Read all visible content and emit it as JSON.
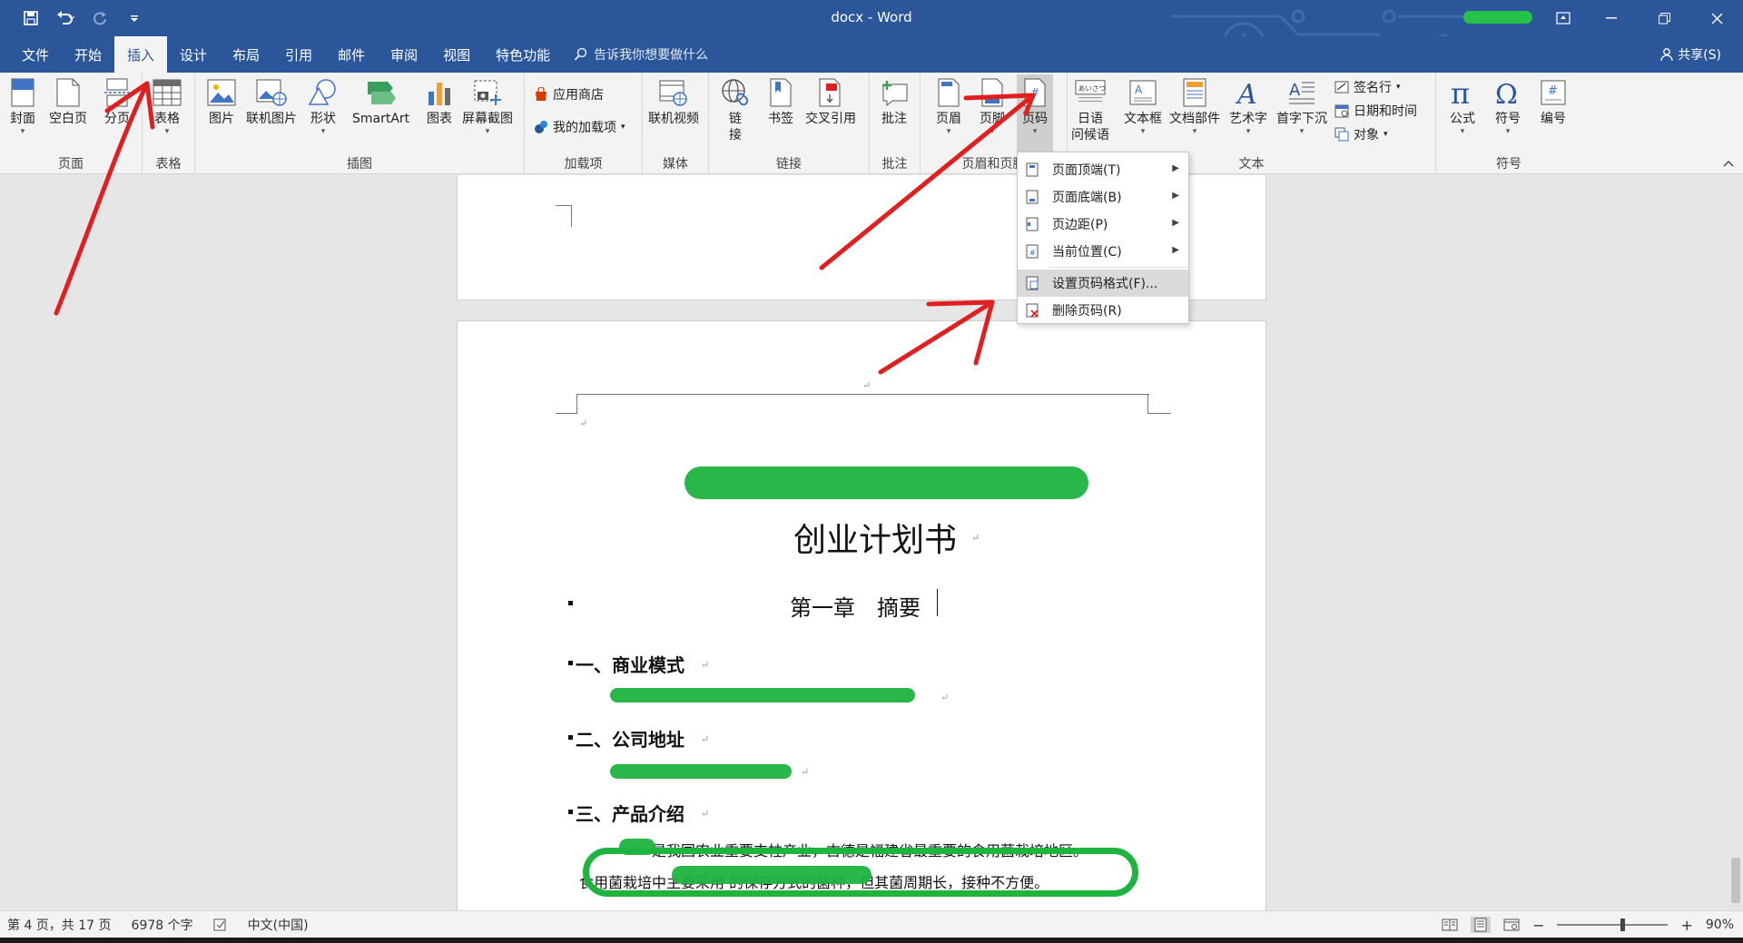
{
  "window": {
    "title": "docx - Word",
    "tooltips_hidden": "",
    "controls": [
      "minimize",
      "restore",
      "close"
    ]
  },
  "qat": {
    "icons": [
      "save-icon",
      "undo-icon",
      "redo-icon",
      "customize-icon"
    ]
  },
  "tabs": [
    {
      "label": "文件",
      "active": false
    },
    {
      "label": "开始",
      "active": false
    },
    {
      "label": "插入",
      "active": true
    },
    {
      "label": "设计",
      "active": false
    },
    {
      "label": "布局",
      "active": false
    },
    {
      "label": "引用",
      "active": false
    },
    {
      "label": "邮件",
      "active": false
    },
    {
      "label": "审阅",
      "active": false
    },
    {
      "label": "视图",
      "active": false
    },
    {
      "label": "特色功能",
      "active": false
    }
  ],
  "tellme": "告诉我你想要做什么",
  "share": "共享(S)",
  "ribbon": {
    "groups": {
      "pages": "页面",
      "tables": "表格",
      "illustrations": "插图",
      "addins": "加载项",
      "media": "媒体",
      "links": "链接",
      "comments": "批注",
      "header_footer": "页眉和页脚",
      "text": "文本",
      "symbols": "符号"
    },
    "buttons": {
      "cover": "封面",
      "blank_page": "空白页",
      "page_break": "分页",
      "table": "表格",
      "picture": "图片",
      "online_picture": "联机图片",
      "shapes": "形状",
      "smartart": "SmartArt",
      "chart": "图表",
      "screenshot": "屏幕截图",
      "store": "应用商店",
      "my_addins": "我的加载项",
      "online_video": "联机视频",
      "link_1": "链",
      "link_2": "接",
      "bookmark": "书签",
      "cross_ref": "交叉引用",
      "comment": "批注",
      "header": "页眉",
      "footer": "页脚",
      "page_number": "页码",
      "greeting_1": "日语",
      "greeting_2": "问候语",
      "textbox": "文本框",
      "doc_parts": "文档部件",
      "wordart": "艺术字",
      "dropcap": "首字下沉",
      "signature": "签名行",
      "datetime": "日期和时间",
      "object": "对象",
      "equation": "公式",
      "symbol": "符号",
      "numbering": "编号"
    }
  },
  "page_number_menu": {
    "items": [
      {
        "label": "页面顶端(T)",
        "submenu": true,
        "highlight": false
      },
      {
        "label": "页面底端(B)",
        "submenu": true,
        "highlight": false
      },
      {
        "label": "页边距(P)",
        "submenu": true,
        "highlight": false
      },
      {
        "label": "当前位置(C)",
        "submenu": true,
        "highlight": false
      },
      {
        "label": "设置页码格式(F)...",
        "submenu": false,
        "highlight": true
      },
      {
        "label": "删除页码(R)",
        "submenu": false,
        "highlight": false
      }
    ]
  },
  "document": {
    "title_line2": "创业计划书",
    "chapter": "第一章　摘要",
    "sections": [
      {
        "heading": "一、商业模式",
        "body": ""
      },
      {
        "heading": "二、公司地址",
        "body": ""
      },
      {
        "heading": "三、产品介绍",
        "body": ""
      }
    ],
    "body_line1": "是我国农业重要支柱产业，古德是福建省最重要的食用菌栽培地区。",
    "body_line2": "食用菌栽培中主要采用 的保存方式的菌种，但其菌周期长，接种不方便。"
  },
  "status": {
    "page": "第 4 页，共 17 页",
    "words": "6978 个字",
    "language": "中文(中国)",
    "zoom": "90%",
    "zoom_level": 0.9
  },
  "colors": {
    "brand": "#2b579a",
    "annotation": "#e02020",
    "redaction": "#1fb33f"
  }
}
